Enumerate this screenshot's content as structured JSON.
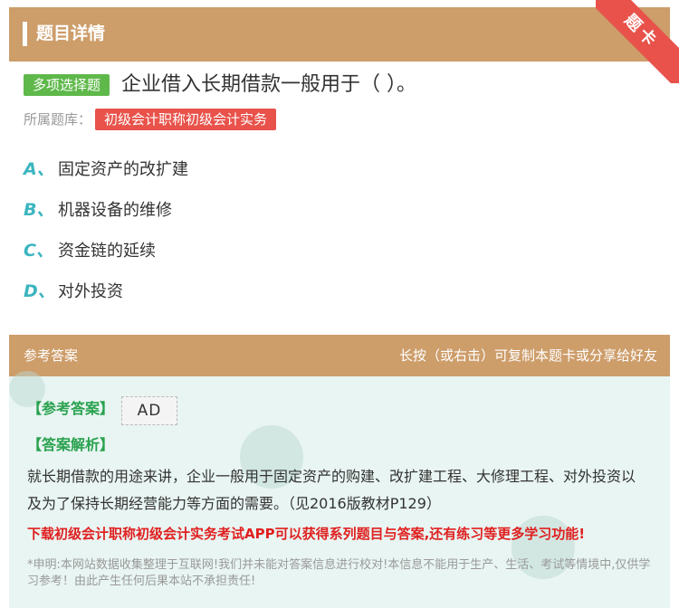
{
  "header": {
    "title": "题目详情"
  },
  "ribbon": {
    "label": "题卡"
  },
  "question": {
    "type_badge": "多项选择题",
    "text": "企业借入长期借款一般用于（ ）。",
    "bank_label": "所属题库：",
    "bank_name": "初级会计职称初级会计实务",
    "options": [
      {
        "letter": "A、",
        "text": "固定资产的改扩建"
      },
      {
        "letter": "B、",
        "text": "机器设备的维修"
      },
      {
        "letter": "C、",
        "text": "资金链的延续"
      },
      {
        "letter": "D、",
        "text": "对外投资"
      }
    ]
  },
  "answer": {
    "section_title": "参考答案",
    "share_hint": "长按（或右击）可复制本题卡或分享给好友",
    "answer_label": "【参考答案】",
    "answer_value": "AD",
    "explain_label": "【答案解析】",
    "explain_text": "就长期借款的用途来讲，企业一般用于固定资产的购建、改扩建工程、大修理工程、对外投资以及为了保持长期经营能力等方面的需要。（见2016版教材P129）",
    "promo": "下载初级会计职称初级会计实务考试APP可以获得系列题目与答案,还有练习等更多学习功能!",
    "disclaimer": "*申明:本网站数据收集整理于互联网!我们并未能对答案信息进行校对!本信息不能用于生产、生活、考试等情境中,仅供学习参考！由此产生任何后果本站不承担责任!"
  },
  "colors": {
    "header_bg": "#cd9d6a",
    "ribbon_bg": "#e8524a",
    "type_badge_bg": "#5fb84a",
    "bank_tag_bg": "#e8524a",
    "option_letter": "#3cb5c0",
    "answer_label": "#2aa24f",
    "promo": "#e02020",
    "panel_bg": "#e8f5f2"
  }
}
